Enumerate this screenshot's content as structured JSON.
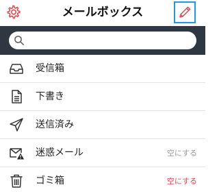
{
  "header": {
    "title": "メールボックス",
    "settings_icon": "gear-icon",
    "compose_icon": "pencil-icon"
  },
  "search": {
    "placeholder": "",
    "icon": "search-icon"
  },
  "mailboxes": [
    {
      "label": "受信箱",
      "icon": "inbox-tray-icon",
      "action": ""
    },
    {
      "label": "下書き",
      "icon": "document-icon",
      "action": ""
    },
    {
      "label": "送信済み",
      "icon": "paper-plane-icon",
      "action": ""
    },
    {
      "label": "迷惑メール",
      "icon": "envelope-warning-icon",
      "action": "空にする"
    },
    {
      "label": "ゴミ箱",
      "icon": "trash-icon",
      "action": "空にする"
    }
  ],
  "colors": {
    "accent": "#e0484f",
    "search_bar": "#2f3842",
    "compose_highlight": "#1a9de0",
    "action_disabled": "#9a9a9a"
  }
}
